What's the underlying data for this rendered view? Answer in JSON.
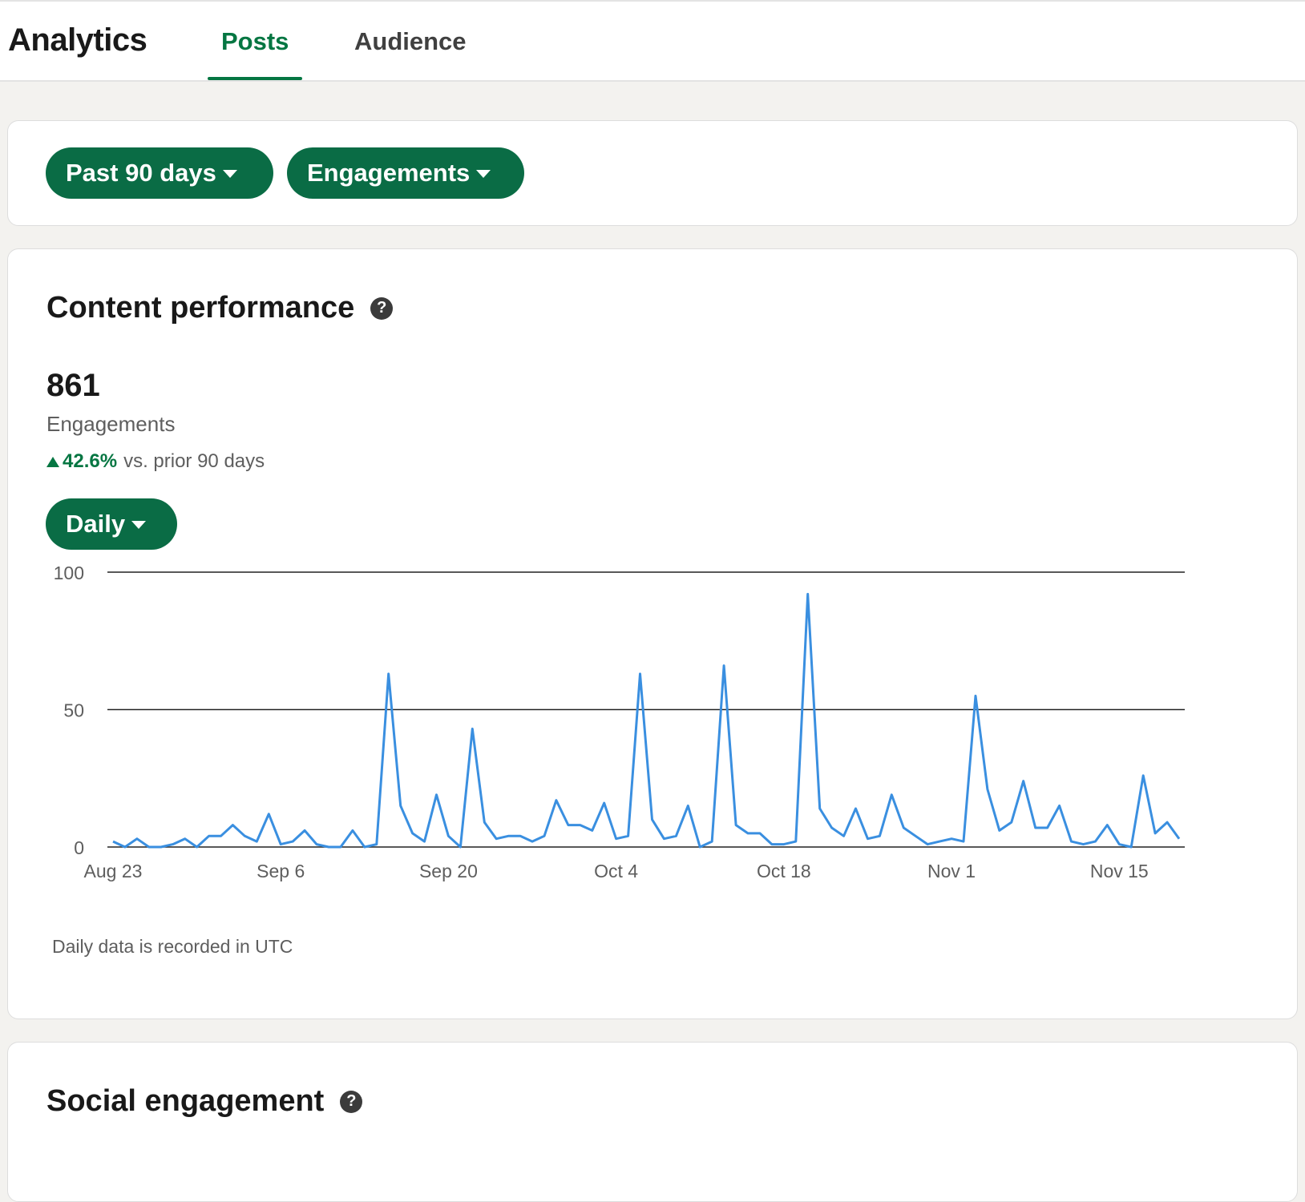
{
  "header": {
    "title": "Analytics",
    "tabs": [
      {
        "label": "Posts",
        "active": true
      },
      {
        "label": "Audience",
        "active": false
      }
    ]
  },
  "filters": {
    "period_label": "Past 90 days",
    "metric_label": "Engagements"
  },
  "content_performance": {
    "title": "Content performance",
    "total_value": "861",
    "metric_label": "Engagements",
    "change_value": "42.6%",
    "change_text": "vs. prior 90 days",
    "granularity_label": "Daily",
    "footnote": "Daily data is recorded in UTC"
  },
  "social_engagement": {
    "title": "Social engagement"
  },
  "colors": {
    "accent": "#057642",
    "pill": "#0a6c45",
    "line": "#3a8fe0"
  },
  "icons": {
    "help": "question-circle-icon",
    "dropdown": "caret-down-icon",
    "trend": "triangle-up-icon"
  },
  "chart_data": {
    "type": "line",
    "xlabel": "",
    "ylabel": "",
    "ylim": [
      0,
      100
    ],
    "yticks": [
      0,
      50,
      100
    ],
    "xtick_labels": [
      "Aug 23",
      "Sep 6",
      "Sep 20",
      "Oct 4",
      "Oct 18",
      "Nov 1",
      "Nov 15"
    ],
    "xtick_indices": [
      0,
      14,
      28,
      42,
      56,
      70,
      84
    ],
    "grid": true,
    "series": [
      {
        "color": "#3a8fe0",
        "values": [
          2,
          0,
          3,
          0,
          0,
          1,
          3,
          0,
          4,
          4,
          8,
          4,
          2,
          12,
          1,
          2,
          6,
          1,
          0,
          0,
          6,
          0,
          1,
          63,
          15,
          5,
          2,
          19,
          4,
          0,
          43,
          9,
          3,
          4,
          4,
          2,
          4,
          17,
          8,
          8,
          6,
          16,
          3,
          4,
          63,
          10,
          3,
          4,
          15,
          0,
          2,
          66,
          8,
          5,
          5,
          1,
          1,
          2,
          92,
          14,
          7,
          4,
          14,
          3,
          4,
          19,
          7,
          4,
          1,
          2,
          3,
          2,
          55,
          21,
          6,
          9,
          24,
          7,
          7,
          15,
          2,
          1,
          2,
          8,
          1,
          0,
          26,
          5,
          9,
          3
        ]
      }
    ]
  }
}
